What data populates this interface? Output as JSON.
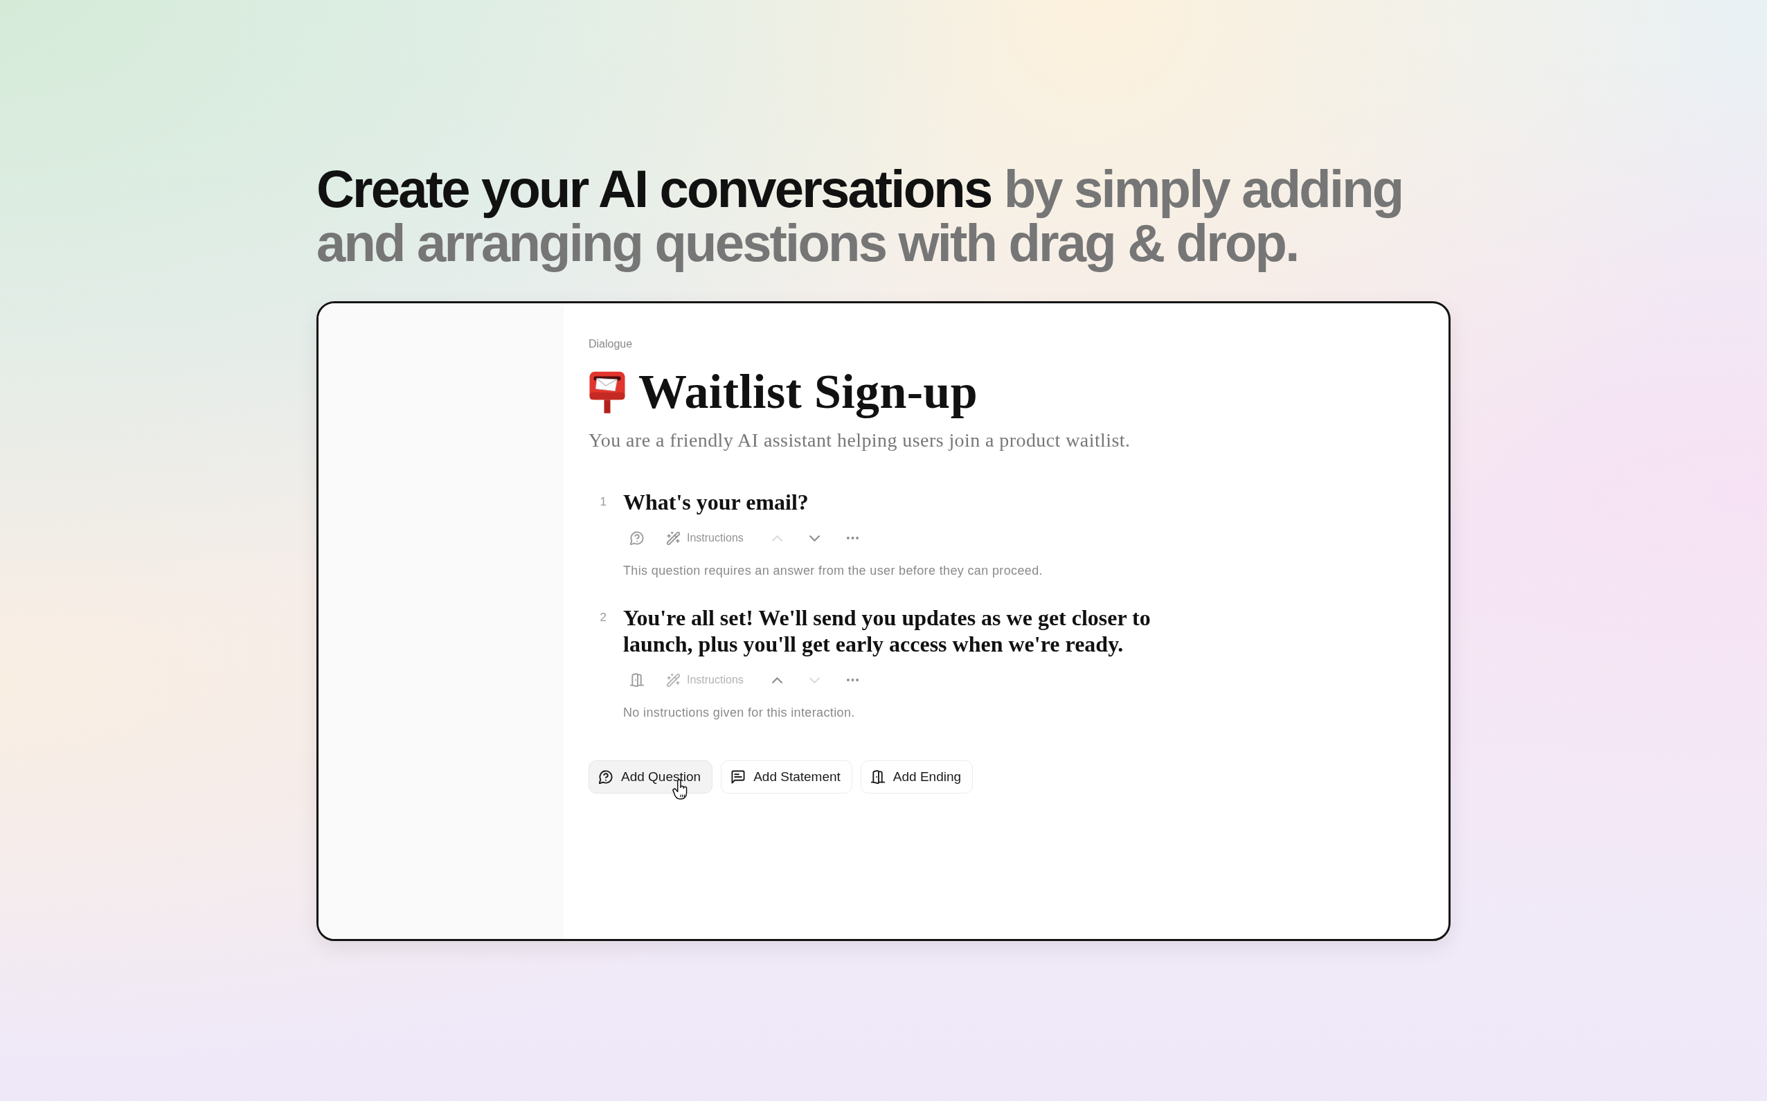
{
  "headline": {
    "lead": "Create your AI conversations",
    "rest": "by simply adding and arranging questions with drag & drop."
  },
  "editor": {
    "breadcrumb": "Dialogue",
    "title": "Waitlist Sign-up",
    "description": "You are a friendly AI assistant helping users join a product waitlist.",
    "items": [
      {
        "kind": "question",
        "number": "1",
        "text": "What's your email?",
        "instructions_label": "Instructions",
        "instructions_disabled": false,
        "move_up_disabled": true,
        "move_down_disabled": false,
        "note": "This question requires an answer from the user before they can proceed."
      },
      {
        "kind": "ending",
        "number": "2",
        "text": "You're all set! We'll send you updates as we get closer to launch, plus you'll get early access when we're ready.",
        "instructions_label": "Instructions",
        "instructions_disabled": true,
        "move_up_disabled": false,
        "move_down_disabled": true,
        "note": "No instructions given for this interaction."
      }
    ],
    "add_buttons": [
      {
        "kind": "question",
        "label": "Add Question",
        "hovered": true
      },
      {
        "kind": "statement",
        "label": "Add Statement",
        "hovered": false
      },
      {
        "kind": "ending",
        "label": "Add Ending",
        "hovered": false
      }
    ]
  }
}
